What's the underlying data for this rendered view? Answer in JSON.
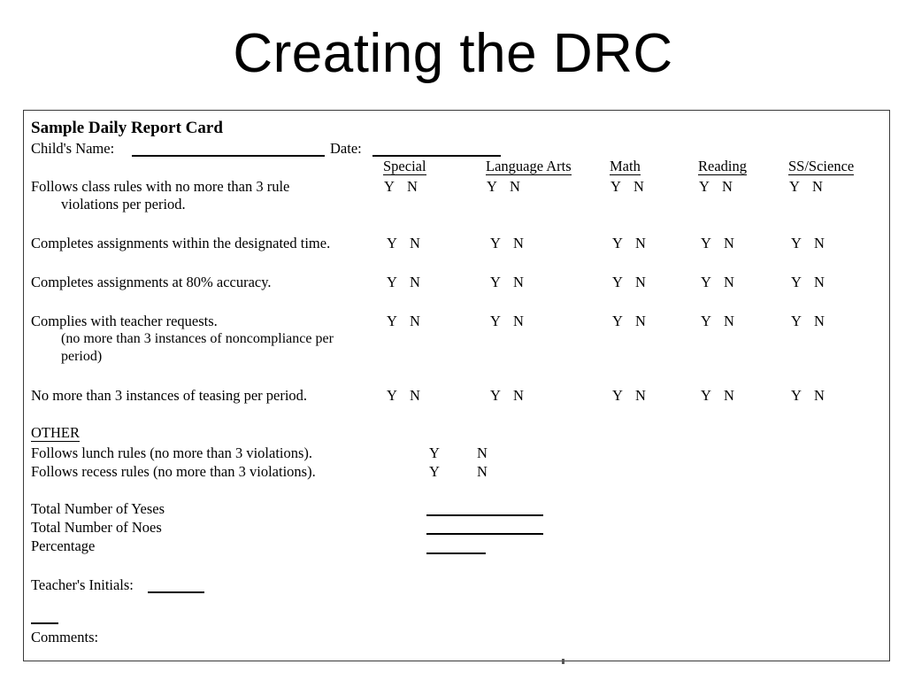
{
  "slide": {
    "title": "Creating the DRC"
  },
  "card": {
    "heading": "Sample Daily Report Card",
    "name_label": "Child's Name:",
    "date_label": "Date:",
    "columns": [
      "Special",
      "Language Arts",
      "Math",
      "Reading",
      "SS/Science"
    ],
    "yes_label": "Y",
    "no_label": "N",
    "rows": [
      {
        "lines": [
          "Follows class rules with no more than 3 rule",
          "violations per period."
        ],
        "columns": 5
      },
      {
        "lines": [
          "Completes assignments within the designated time."
        ],
        "columns": 5
      },
      {
        "lines": [
          "Completes assignments at 80% accuracy."
        ],
        "columns": 5
      },
      {
        "lines": [
          "Complies with teacher requests.",
          "(no more than 3 instances of noncompliance per",
          "period)"
        ],
        "columns": 5
      },
      {
        "lines": [
          "No more than 3 instances of teasing per period."
        ],
        "columns": 5
      }
    ],
    "other": {
      "heading": "OTHER",
      "items": [
        "Follows lunch rules (no more than 3 violations).",
        "Follows recess rules  (no more than 3 violations)."
      ]
    },
    "totals": [
      "Total Number of Yeses",
      "Total Number of Noes",
      "Percentage"
    ],
    "initials_label": "Teacher's Initials:",
    "comments_label": "Comments:"
  }
}
